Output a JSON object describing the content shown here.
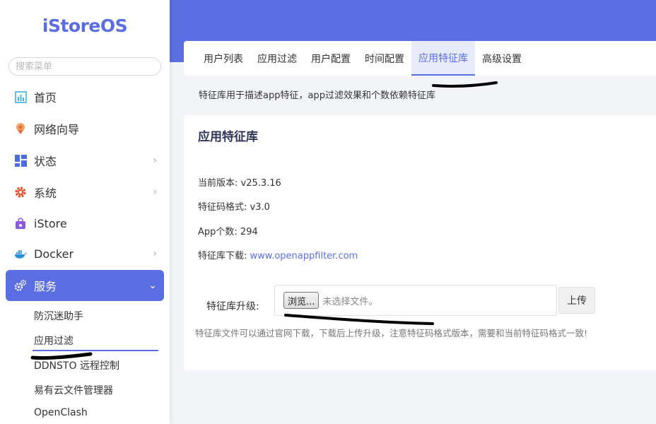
{
  "brand": {
    "name": "iStoreOS",
    "color": "#5b6ee1"
  },
  "search": {
    "placeholder": "搜索菜单"
  },
  "sidebar": {
    "items": [
      {
        "label": "首页",
        "icon": "chart-icon",
        "chevron": false
      },
      {
        "label": "网络向导",
        "icon": "globe-pin-icon",
        "chevron": false
      },
      {
        "label": "状态",
        "icon": "dashboard-grid-icon",
        "chevron": true
      },
      {
        "label": "系统",
        "icon": "gear-icon",
        "chevron": true
      },
      {
        "label": "iStore",
        "icon": "store-bag-icon",
        "chevron": false
      },
      {
        "label": "Docker",
        "icon": "docker-whale-icon",
        "chevron": true
      },
      {
        "label": "服务",
        "icon": "services-gears-icon",
        "chevron": true,
        "active": true
      }
    ],
    "sub_items": [
      {
        "label": "防沉迷助手"
      },
      {
        "label": "应用过滤",
        "active": true
      },
      {
        "label": "DDNSTO 远程控制"
      },
      {
        "label": "易有云文件管理器"
      },
      {
        "label": "OpenClash"
      }
    ]
  },
  "tabs": [
    {
      "label": "用户列表"
    },
    {
      "label": "应用过滤"
    },
    {
      "label": "用户配置"
    },
    {
      "label": "时间配置"
    },
    {
      "label": "应用特征库",
      "active": true
    },
    {
      "label": "高级设置"
    }
  ],
  "description": "特征库用于描述app特征，app过滤效果和个数依赖特征库",
  "section": {
    "title": "应用特征库",
    "version_label": "当前版本: ",
    "version_value": "v25.3.16",
    "format_label": "特征码格式: ",
    "format_value": "v3.0",
    "app_count_label": "App个数: ",
    "app_count_value": "294",
    "download_label": "特征库下载: ",
    "download_link": "www.openappfilter.com"
  },
  "upgrade": {
    "label": "特征库升级:",
    "browse_label": "浏览...",
    "file_status": "未选择文件。",
    "upload_label": "上传",
    "hint": "特征库文件可以通过官网下载，下载后上传升级，注意特征码格式版本，需要和当前特征码格式一致!"
  },
  "colors": {
    "accent": "#5b6ee1",
    "background": "#f3f4f8",
    "title": "#2c3555"
  }
}
